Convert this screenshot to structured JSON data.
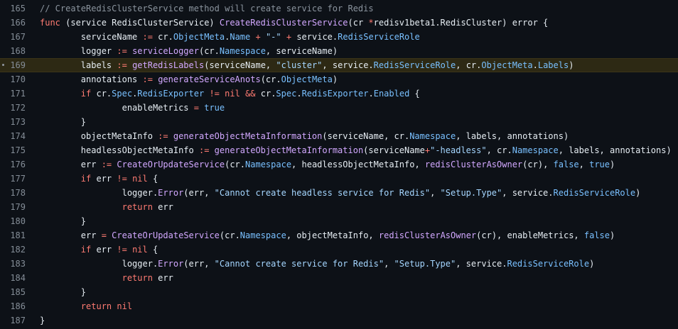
{
  "theme": {
    "background": "#0d1117",
    "highlight_line_bg": "#2d2914",
    "line_number_color": "#848d97",
    "keyword_color": "#ff7b72",
    "function_color": "#d2a8ff",
    "property_color": "#79c0ff",
    "string_color": "#a5d6ff",
    "comment_color": "#8b949e",
    "text_color": "#e6edf3"
  },
  "code": {
    "highlighted_line": "169",
    "lines": [
      {
        "num": "165",
        "indent": 0,
        "tokens": [
          {
            "t": "cm",
            "v": "// CreateRedisClusterService method will create service for Redis"
          }
        ]
      },
      {
        "num": "166",
        "indent": 0,
        "tokens": [
          {
            "t": "kw",
            "v": "func"
          },
          {
            "t": "pl",
            "v": " (service RedisClusterService) "
          },
          {
            "t": "fn",
            "v": "CreateRedisClusterService"
          },
          {
            "t": "pl",
            "v": "(cr "
          },
          {
            "t": "op",
            "v": "*"
          },
          {
            "t": "pl",
            "v": "redisv1beta1.RedisCluster) error {"
          }
        ]
      },
      {
        "num": "167",
        "indent": 1,
        "tokens": [
          {
            "t": "pl",
            "v": "serviceName "
          },
          {
            "t": "op",
            "v": ":="
          },
          {
            "t": "pl",
            "v": " cr."
          },
          {
            "t": "prop",
            "v": "ObjectMeta"
          },
          {
            "t": "pl",
            "v": "."
          },
          {
            "t": "prop",
            "v": "Name"
          },
          {
            "t": "pl",
            "v": " "
          },
          {
            "t": "op",
            "v": "+"
          },
          {
            "t": "pl",
            "v": " "
          },
          {
            "t": "str",
            "v": "\"-\""
          },
          {
            "t": "pl",
            "v": " "
          },
          {
            "t": "op",
            "v": "+"
          },
          {
            "t": "pl",
            "v": " service."
          },
          {
            "t": "prop",
            "v": "RedisServiceRole"
          }
        ]
      },
      {
        "num": "168",
        "indent": 1,
        "tokens": [
          {
            "t": "pl",
            "v": "logger "
          },
          {
            "t": "op",
            "v": ":="
          },
          {
            "t": "pl",
            "v": " "
          },
          {
            "t": "fn",
            "v": "serviceLogger"
          },
          {
            "t": "pl",
            "v": "(cr."
          },
          {
            "t": "prop",
            "v": "Namespace"
          },
          {
            "t": "pl",
            "v": ", serviceName)"
          }
        ]
      },
      {
        "num": "169",
        "indent": 1,
        "tokens": [
          {
            "t": "pl",
            "v": "labels "
          },
          {
            "t": "op",
            "v": ":="
          },
          {
            "t": "pl",
            "v": " "
          },
          {
            "t": "fn",
            "v": "getRedisLabels"
          },
          {
            "t": "pl",
            "v": "(serviceName, "
          },
          {
            "t": "str",
            "v": "\"cluster\""
          },
          {
            "t": "pl",
            "v": ", service."
          },
          {
            "t": "prop",
            "v": "RedisServiceRole"
          },
          {
            "t": "pl",
            "v": ", cr."
          },
          {
            "t": "prop",
            "v": "ObjectMeta"
          },
          {
            "t": "pl",
            "v": "."
          },
          {
            "t": "prop",
            "v": "Labels"
          },
          {
            "t": "pl",
            "v": ")"
          }
        ]
      },
      {
        "num": "170",
        "indent": 1,
        "tokens": [
          {
            "t": "pl",
            "v": "annotations "
          },
          {
            "t": "op",
            "v": ":="
          },
          {
            "t": "pl",
            "v": " "
          },
          {
            "t": "fn",
            "v": "generateServiceAnots"
          },
          {
            "t": "pl",
            "v": "(cr."
          },
          {
            "t": "prop",
            "v": "ObjectMeta"
          },
          {
            "t": "pl",
            "v": ")"
          }
        ]
      },
      {
        "num": "171",
        "indent": 1,
        "tokens": [
          {
            "t": "kw",
            "v": "if"
          },
          {
            "t": "pl",
            "v": " cr."
          },
          {
            "t": "prop",
            "v": "Spec"
          },
          {
            "t": "pl",
            "v": "."
          },
          {
            "t": "prop",
            "v": "RedisExporter"
          },
          {
            "t": "pl",
            "v": " "
          },
          {
            "t": "op",
            "v": "!="
          },
          {
            "t": "pl",
            "v": " "
          },
          {
            "t": "kw",
            "v": "nil"
          },
          {
            "t": "pl",
            "v": " "
          },
          {
            "t": "op",
            "v": "&&"
          },
          {
            "t": "pl",
            "v": " cr."
          },
          {
            "t": "prop",
            "v": "Spec"
          },
          {
            "t": "pl",
            "v": "."
          },
          {
            "t": "prop",
            "v": "RedisExporter"
          },
          {
            "t": "pl",
            "v": "."
          },
          {
            "t": "prop",
            "v": "Enabled"
          },
          {
            "t": "pl",
            "v": " {"
          }
        ]
      },
      {
        "num": "172",
        "indent": 2,
        "tokens": [
          {
            "t": "pl",
            "v": "enableMetrics "
          },
          {
            "t": "op",
            "v": "="
          },
          {
            "t": "pl",
            "v": " "
          },
          {
            "t": "prop",
            "v": "true"
          }
        ]
      },
      {
        "num": "173",
        "indent": 1,
        "tokens": [
          {
            "t": "pl",
            "v": "}"
          }
        ]
      },
      {
        "num": "174",
        "indent": 1,
        "tokens": [
          {
            "t": "pl",
            "v": "objectMetaInfo "
          },
          {
            "t": "op",
            "v": ":="
          },
          {
            "t": "pl",
            "v": " "
          },
          {
            "t": "fn",
            "v": "generateObjectMetaInformation"
          },
          {
            "t": "pl",
            "v": "(serviceName, cr."
          },
          {
            "t": "prop",
            "v": "Namespace"
          },
          {
            "t": "pl",
            "v": ", labels, annotations)"
          }
        ]
      },
      {
        "num": "175",
        "indent": 1,
        "tokens": [
          {
            "t": "pl",
            "v": "headlessObjectMetaInfo "
          },
          {
            "t": "op",
            "v": ":="
          },
          {
            "t": "pl",
            "v": " "
          },
          {
            "t": "fn",
            "v": "generateObjectMetaInformation"
          },
          {
            "t": "pl",
            "v": "(serviceName"
          },
          {
            "t": "op",
            "v": "+"
          },
          {
            "t": "str",
            "v": "\"-headless\""
          },
          {
            "t": "pl",
            "v": ", cr."
          },
          {
            "t": "prop",
            "v": "Namespace"
          },
          {
            "t": "pl",
            "v": ", labels, annotations)"
          }
        ]
      },
      {
        "num": "176",
        "indent": 1,
        "tokens": [
          {
            "t": "pl",
            "v": "err "
          },
          {
            "t": "op",
            "v": ":="
          },
          {
            "t": "pl",
            "v": " "
          },
          {
            "t": "fn",
            "v": "CreateOrUpdateService"
          },
          {
            "t": "pl",
            "v": "(cr."
          },
          {
            "t": "prop",
            "v": "Namespace"
          },
          {
            "t": "pl",
            "v": ", headlessObjectMetaInfo, "
          },
          {
            "t": "fn",
            "v": "redisClusterAsOwner"
          },
          {
            "t": "pl",
            "v": "(cr), "
          },
          {
            "t": "prop",
            "v": "false"
          },
          {
            "t": "pl",
            "v": ", "
          },
          {
            "t": "prop",
            "v": "true"
          },
          {
            "t": "pl",
            "v": ")"
          }
        ]
      },
      {
        "num": "177",
        "indent": 1,
        "tokens": [
          {
            "t": "kw",
            "v": "if"
          },
          {
            "t": "pl",
            "v": " err "
          },
          {
            "t": "op",
            "v": "!="
          },
          {
            "t": "pl",
            "v": " "
          },
          {
            "t": "kw",
            "v": "nil"
          },
          {
            "t": "pl",
            "v": " {"
          }
        ]
      },
      {
        "num": "178",
        "indent": 2,
        "tokens": [
          {
            "t": "pl",
            "v": "logger."
          },
          {
            "t": "fn",
            "v": "Error"
          },
          {
            "t": "pl",
            "v": "(err, "
          },
          {
            "t": "str",
            "v": "\"Cannot create headless service for Redis\""
          },
          {
            "t": "pl",
            "v": ", "
          },
          {
            "t": "str",
            "v": "\"Setup.Type\""
          },
          {
            "t": "pl",
            "v": ", service."
          },
          {
            "t": "prop",
            "v": "RedisServiceRole"
          },
          {
            "t": "pl",
            "v": ")"
          }
        ]
      },
      {
        "num": "179",
        "indent": 2,
        "tokens": [
          {
            "t": "kw",
            "v": "return"
          },
          {
            "t": "pl",
            "v": " err"
          }
        ]
      },
      {
        "num": "180",
        "indent": 1,
        "tokens": [
          {
            "t": "pl",
            "v": "}"
          }
        ]
      },
      {
        "num": "181",
        "indent": 1,
        "tokens": [
          {
            "t": "pl",
            "v": "err "
          },
          {
            "t": "op",
            "v": "="
          },
          {
            "t": "pl",
            "v": " "
          },
          {
            "t": "fn",
            "v": "CreateOrUpdateService"
          },
          {
            "t": "pl",
            "v": "(cr."
          },
          {
            "t": "prop",
            "v": "Namespace"
          },
          {
            "t": "pl",
            "v": ", objectMetaInfo, "
          },
          {
            "t": "fn",
            "v": "redisClusterAsOwner"
          },
          {
            "t": "pl",
            "v": "(cr), enableMetrics, "
          },
          {
            "t": "prop",
            "v": "false"
          },
          {
            "t": "pl",
            "v": ")"
          }
        ]
      },
      {
        "num": "182",
        "indent": 1,
        "tokens": [
          {
            "t": "kw",
            "v": "if"
          },
          {
            "t": "pl",
            "v": " err "
          },
          {
            "t": "op",
            "v": "!="
          },
          {
            "t": "pl",
            "v": " "
          },
          {
            "t": "kw",
            "v": "nil"
          },
          {
            "t": "pl",
            "v": " {"
          }
        ]
      },
      {
        "num": "183",
        "indent": 2,
        "tokens": [
          {
            "t": "pl",
            "v": "logger."
          },
          {
            "t": "fn",
            "v": "Error"
          },
          {
            "t": "pl",
            "v": "(err, "
          },
          {
            "t": "str",
            "v": "\"Cannot create service for Redis\""
          },
          {
            "t": "pl",
            "v": ", "
          },
          {
            "t": "str",
            "v": "\"Setup.Type\""
          },
          {
            "t": "pl",
            "v": ", service."
          },
          {
            "t": "prop",
            "v": "RedisServiceRole"
          },
          {
            "t": "pl",
            "v": ")"
          }
        ]
      },
      {
        "num": "184",
        "indent": 2,
        "tokens": [
          {
            "t": "kw",
            "v": "return"
          },
          {
            "t": "pl",
            "v": " err"
          }
        ]
      },
      {
        "num": "185",
        "indent": 1,
        "tokens": [
          {
            "t": "pl",
            "v": "}"
          }
        ]
      },
      {
        "num": "186",
        "indent": 1,
        "tokens": [
          {
            "t": "kw",
            "v": "return"
          },
          {
            "t": "pl",
            "v": " "
          },
          {
            "t": "kw",
            "v": "nil"
          }
        ]
      },
      {
        "num": "187",
        "indent": 0,
        "tokens": [
          {
            "t": "pl",
            "v": "}"
          }
        ]
      }
    ]
  }
}
